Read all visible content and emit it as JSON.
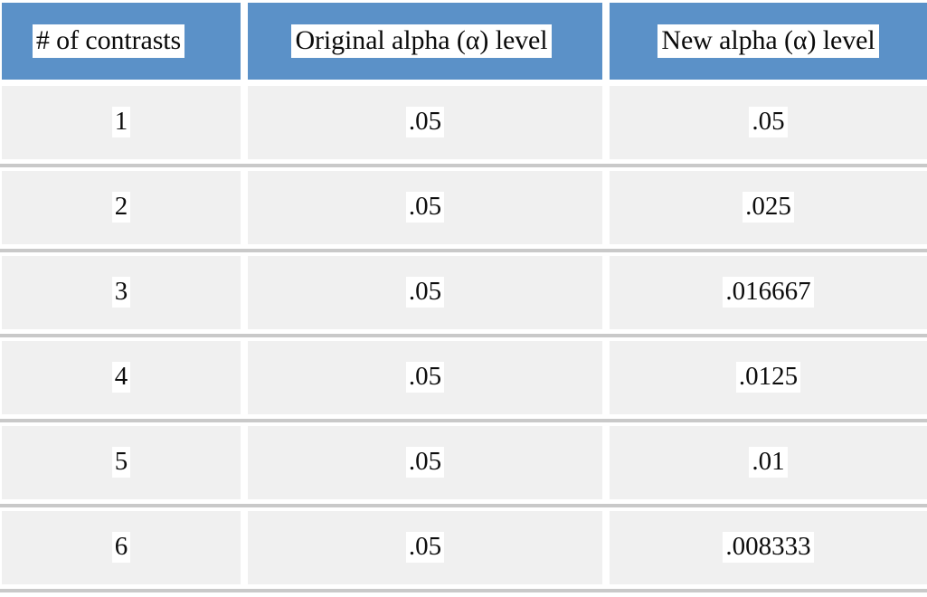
{
  "table": {
    "headers": [
      {
        "label": "# of contrasts"
      },
      {
        "label": "Original alpha (α) level"
      },
      {
        "label": "New alpha (α) level"
      }
    ],
    "rows": [
      {
        "contrasts": "1",
        "original_alpha": ".05",
        "new_alpha": ".05"
      },
      {
        "contrasts": "2",
        "original_alpha": ".05",
        "new_alpha": ".025"
      },
      {
        "contrasts": "3",
        "original_alpha": ".05",
        "new_alpha": ".016667"
      },
      {
        "contrasts": "4",
        "original_alpha": ".05",
        "new_alpha": ".0125"
      },
      {
        "contrasts": "5",
        "original_alpha": ".05",
        "new_alpha": ".01"
      },
      {
        "contrasts": "6",
        "original_alpha": ".05",
        "new_alpha": ".008333"
      }
    ]
  },
  "colors": {
    "header_background": "#5b91c8",
    "cell_background": "#f0f0f0",
    "divider": "#c9c9c9",
    "text_highlight": "#ffffff",
    "text": "#0d0d0d",
    "page_background": "#ffffff"
  }
}
